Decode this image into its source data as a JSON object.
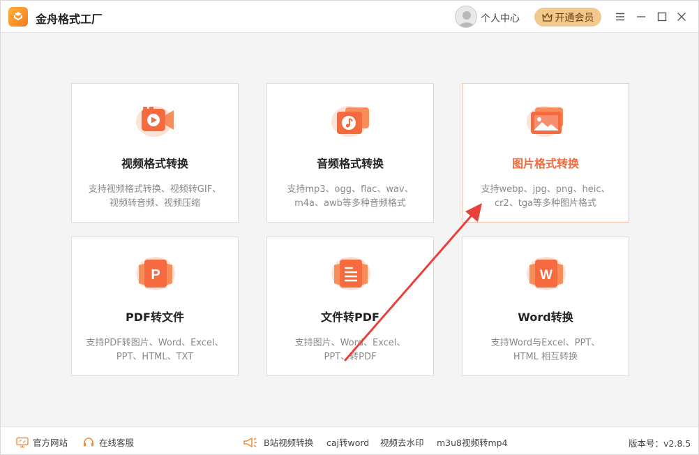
{
  "app": {
    "title": "金舟格式工厂"
  },
  "header": {
    "user_center": "个人中心",
    "vip_button": "开通会员"
  },
  "cards": [
    {
      "title": "视频格式转换",
      "desc": [
        "支持视频格式转换、视频转GIF、",
        "视频转音频、视频压缩"
      ]
    },
    {
      "title": "音频格式转换",
      "desc": [
        "支持mp3、ogg、flac、wav、",
        "m4a、awb等多种音频格式"
      ]
    },
    {
      "title": "图片格式转换",
      "desc": [
        "支持webp、jpg、png、heic、",
        "cr2、tga等多种图片格式"
      ]
    },
    {
      "title": "PDF转文件",
      "desc": [
        "支持PDF转图片、Word、Excel、",
        "PPT、HTML、TXT"
      ]
    },
    {
      "title": "文件转PDF",
      "desc": [
        "支持图片、Word、Excel、",
        "PPT、转PDF"
      ]
    },
    {
      "title": "Word转换",
      "desc": [
        "支持Word与Excel、PPT、",
        "HTML 相互转换"
      ]
    }
  ],
  "icons": {
    "pdf_letter": "P",
    "word_letter": "W"
  },
  "footer": {
    "website": "官方网站",
    "service": "在线客服",
    "bili": "B站视频转换",
    "caj": "caj转word",
    "watermark": "视频去水印",
    "m3u8": "m3u8视频转mp4",
    "version": "版本号：v2.8.5"
  },
  "colors": {
    "accent": "#f26a3d",
    "active_border": "#f7c6b1",
    "vip_bg": "#f1c98c",
    "arrow": "#e8413b"
  }
}
